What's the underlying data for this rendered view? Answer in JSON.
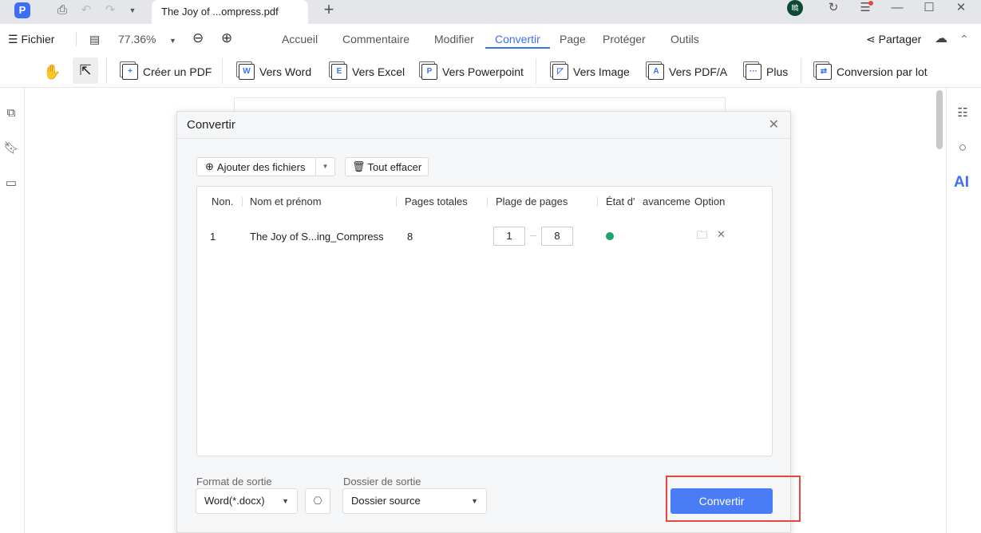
{
  "tabbar": {
    "logo": "P",
    "tab_title": "The Joy of ...ompress.pdf",
    "avatar": "曉"
  },
  "menubar": {
    "file": "Fichier",
    "zoom": "77.36%",
    "items": [
      "Accueil",
      "Commentaire",
      "Modifier",
      "Convertir",
      "Page",
      "Protéger",
      "Outils"
    ],
    "active": "Convertir",
    "share": "Partager"
  },
  "toolbar": {
    "items": [
      {
        "label": "Créer un PDF",
        "glyph": "+"
      },
      {
        "label": "Vers Word",
        "glyph": "W"
      },
      {
        "label": "Vers Excel",
        "glyph": "E"
      },
      {
        "label": "Vers Powerpoint",
        "glyph": "P"
      },
      {
        "label": "Vers Image",
        "glyph": "◸"
      },
      {
        "label": "Vers PDF/A",
        "glyph": "A"
      },
      {
        "label": "Plus",
        "glyph": "···"
      },
      {
        "label": "Conversion par lot",
        "glyph": "⇄"
      }
    ]
  },
  "rightbar": {
    "ai": "AI"
  },
  "dialog": {
    "title": "Convertir",
    "add_files": "Ajouter des fichiers",
    "clear_all": "Tout effacer",
    "columns": [
      "Non.",
      "Nom et prénom",
      "Pages totales",
      "Plage de pages",
      "État d'",
      "avanceme",
      "Option"
    ],
    "rows": [
      {
        "no": "1",
        "name": "The Joy of S...ing_Compress",
        "pages": "8",
        "from": "1",
        "to": "8",
        "status": "done"
      }
    ],
    "format_label": "Format de sortie",
    "format_value": "Word(*.docx)",
    "folder_label": "Dossier de sortie",
    "folder_value": "Dossier source",
    "convert": "Convertir"
  },
  "colors": {
    "accent": "#3d6ef5",
    "highlight": "#e8473f",
    "success": "#1aa36b"
  }
}
